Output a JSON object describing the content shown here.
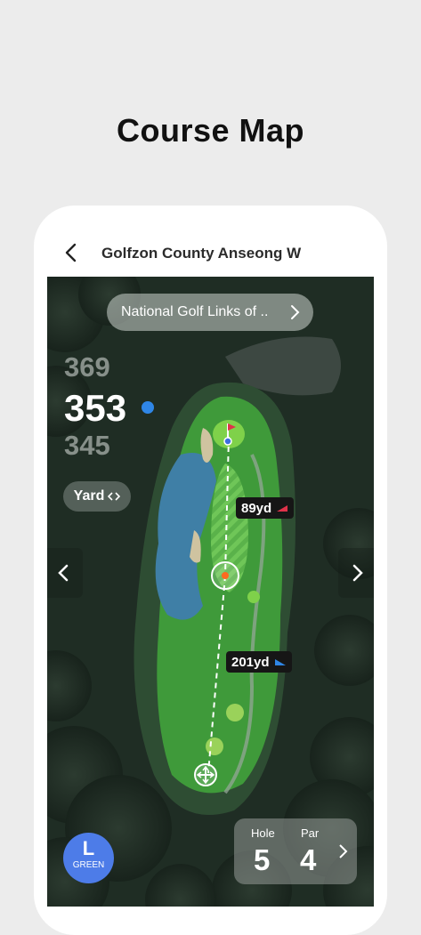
{
  "page": {
    "title": "Course Map"
  },
  "header": {
    "course_name": "Golfzon County Anseong W"
  },
  "map": {
    "course_selector": "National Golf Links of ..",
    "distances": {
      "back": "369",
      "center": "353",
      "front": "345"
    },
    "unit_label": "Yard",
    "labels": {
      "upper": "89yd",
      "lower": "201yd"
    }
  },
  "bottom": {
    "green": {
      "letter": "L",
      "label": "GREEN"
    },
    "hole": {
      "hole_label": "Hole",
      "hole_value": "5",
      "par_label": "Par",
      "par_value": "4"
    }
  },
  "colors": {
    "fairway": "#3f9a3a",
    "green": "#7fd14a",
    "water": "#3f7fa6",
    "accent": "#4d7ce8",
    "slope_down": "#e0324a",
    "slope_up": "#2f86e6"
  }
}
